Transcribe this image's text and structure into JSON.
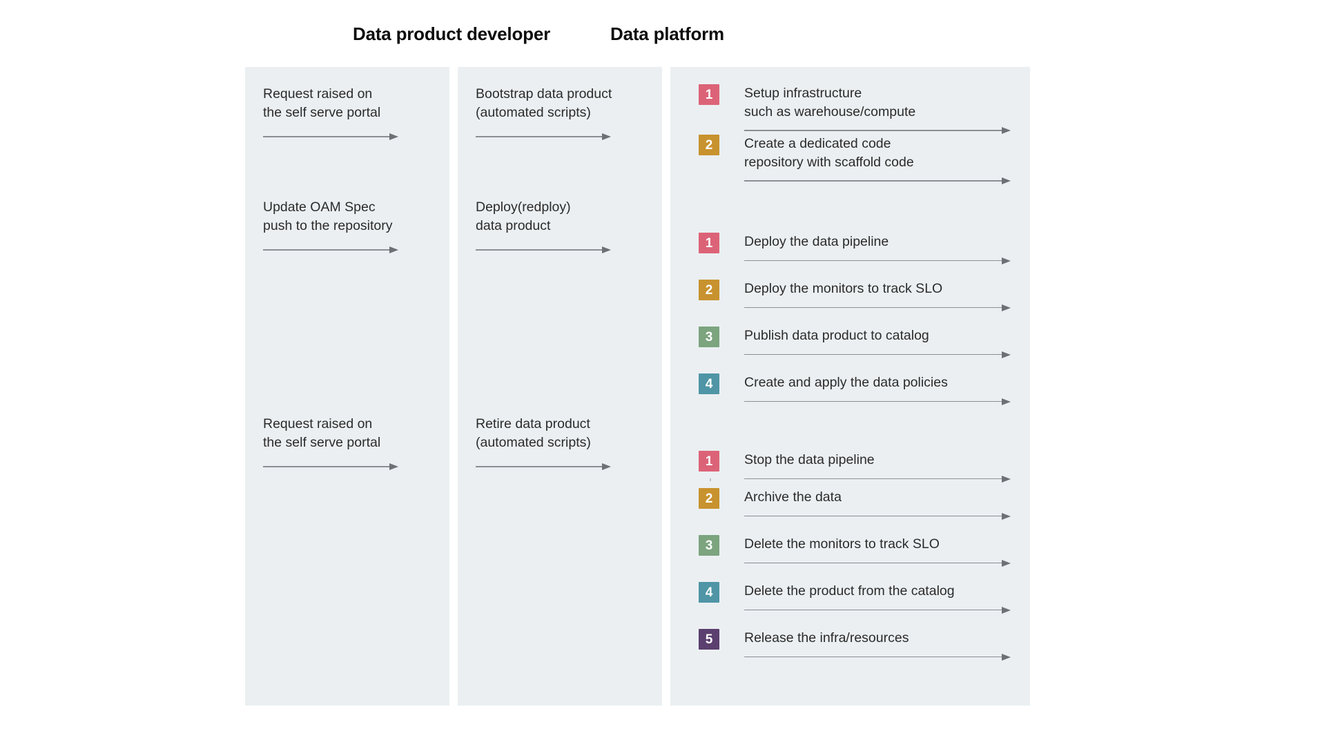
{
  "headers": {
    "developer": "Data product developer",
    "platform": "Data platform"
  },
  "colors": {
    "panel_bg": "#ebeff2",
    "page_bg": "#ffffff",
    "text": "#2b2b2b",
    "heading": "#0d0d0d",
    "arrow": "#6d7176",
    "badge_1": "#dc6377",
    "badge_2": "#c8922e",
    "badge_3": "#7ca47e",
    "badge_4": "#4f95a6",
    "badge_5": "#5b3f6e"
  },
  "lanes": [
    {
      "name": "developer-request",
      "steps": [
        {
          "text": "Request raised on\nthe self serve portal"
        },
        {
          "text": "Update OAM Spec\npush to the repository"
        },
        {
          "text": "Request raised on\nthe self serve portal"
        }
      ]
    },
    {
      "name": "developer-action",
      "steps": [
        {
          "text": "Bootstrap data product\n(automated scripts)"
        },
        {
          "text": "Deploy(redploy)\ndata product"
        },
        {
          "text": "Retire data product\n(automated scripts)"
        }
      ]
    }
  ],
  "platform_groups": [
    {
      "name": "bootstrap",
      "steps": [
        {
          "number": "1",
          "color": "#dc6377",
          "text": "Setup infrastructure\nsuch as warehouse/compute"
        },
        {
          "number": "2",
          "color": "#c8922e",
          "text": "Create a dedicated code\nrepository with scaffold code"
        }
      ]
    },
    {
      "name": "deploy",
      "steps": [
        {
          "number": "1",
          "color": "#dc6377",
          "text": "Deploy the data pipeline"
        },
        {
          "number": "2",
          "color": "#c8922e",
          "text": "Deploy the monitors to track SLO"
        },
        {
          "number": "3",
          "color": "#7ca47e",
          "text": "Publish data product to catalog"
        },
        {
          "number": "4",
          "color": "#4f95a6",
          "text": "Create and apply the data policies"
        }
      ]
    },
    {
      "name": "retire",
      "steps": [
        {
          "number": "1",
          "color": "#dc6377",
          "text": "Stop the data pipeline"
        },
        {
          "number": "2",
          "color": "#c8922e",
          "text": "Archive the data"
        },
        {
          "number": "3",
          "color": "#7ca47e",
          "text": "Delete the monitors to track SLO"
        },
        {
          "number": "4",
          "color": "#4f95a6",
          "text": "Delete the product from the catalog"
        },
        {
          "number": "5",
          "color": "#5b3f6e",
          "text": "Release the infra/resources"
        }
      ]
    }
  ]
}
